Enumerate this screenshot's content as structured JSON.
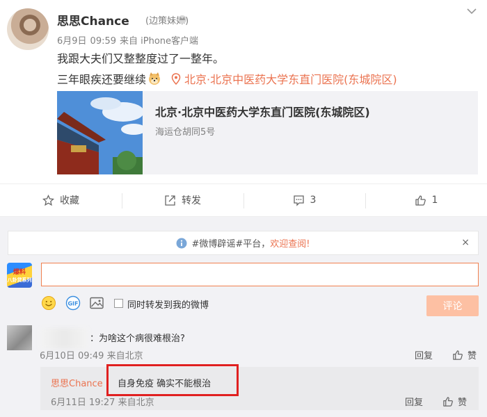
{
  "post": {
    "author": "思思Chance",
    "remark": "(边策妹妹)",
    "date": "6月9日",
    "time": "09:59",
    "source": "来自 iPhone客户端",
    "line1": "我跟大夫们又整整度过了一整年。",
    "line2": "三年眼疾还要继续",
    "location": "北京·北京中医药大学东直门医院(东城院区)",
    "location_card": {
      "title": "北京·北京中医药大学东直门医院(东城院区)",
      "address": "海运仓胡同5号"
    }
  },
  "actions": {
    "favorite": "收藏",
    "repost": "转发",
    "comment_count": "3",
    "like_count": "1"
  },
  "notice": {
    "prefix": "#微博辟谣#平台，",
    "highlight": "欢迎查阅!",
    "close": "×"
  },
  "composer": {
    "avatar_text_top": "爆料",
    "avatar_text_bottom": "八卦贷系列",
    "input_value": "",
    "repost_label": "同时转发到我的微博",
    "submit_label": "评论"
  },
  "comments": [
    {
      "text": "：为啥这个病很难根治?",
      "date": "6月10日",
      "time": "09:49",
      "source": "来自北京",
      "reply_label": "回复",
      "like_label": "赞"
    }
  ],
  "reply": {
    "author": "思思Chance",
    "text": "自身免疫 确实不能根治",
    "date": "6月11日",
    "time": "19:27",
    "source": "来自北京",
    "reply_label": "回复",
    "like_label": "赞"
  },
  "colors": {
    "accent": "#eb7350",
    "highlight_border": "#e02020"
  }
}
